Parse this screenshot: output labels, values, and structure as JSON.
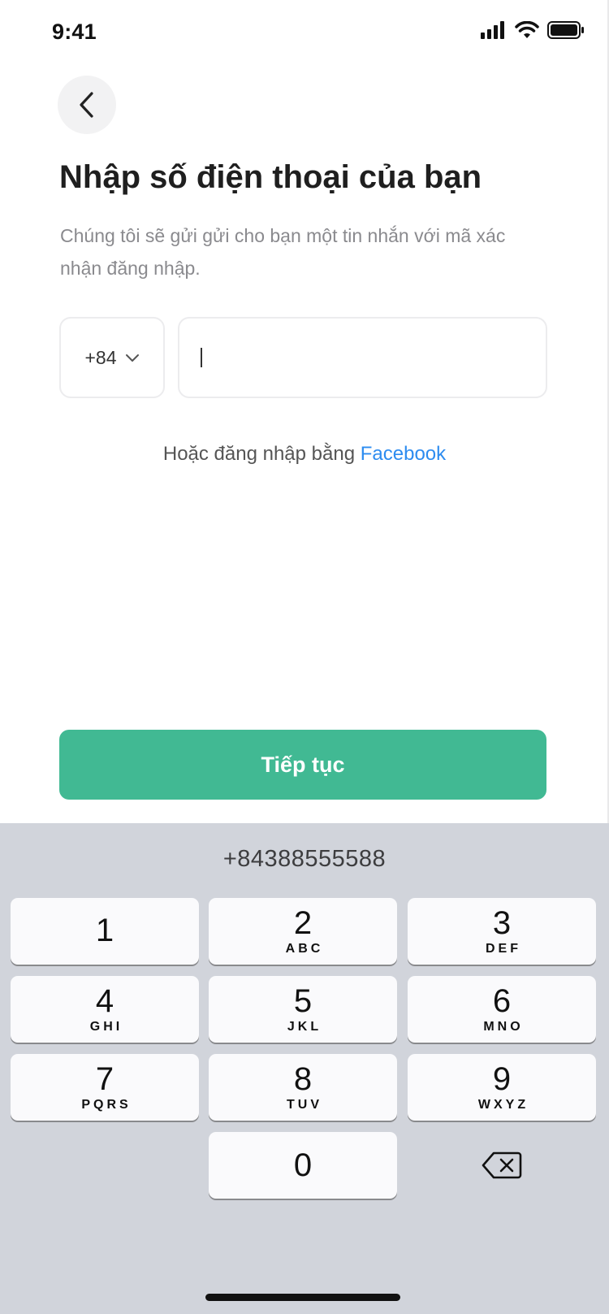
{
  "status_bar": {
    "time": "9:41",
    "icons": [
      "cellular-signal-icon",
      "wifi-icon",
      "battery-icon"
    ]
  },
  "header": {
    "back_icon": "chevron-left-icon",
    "title": "Nhập số điện thoại của bạn",
    "subtitle": "Chúng tôi sẽ gửi gửi cho bạn một tin nhắn với mã xác nhận đăng nhập."
  },
  "form": {
    "country_code": "+84",
    "country_code_icon": "chevron-down-icon",
    "phone_value": ""
  },
  "alt_login": {
    "prefix": "Hoặc đăng nhập bằng",
    "link_label": "Facebook",
    "link_color": "#2d8cf0"
  },
  "continue_button": {
    "label": "Tiếp tục",
    "color": "#41b993"
  },
  "keyboard": {
    "suggestion": "+84388555588",
    "keys": [
      {
        "digit": "1",
        "letters": ""
      },
      {
        "digit": "2",
        "letters": "ABC"
      },
      {
        "digit": "3",
        "letters": "DEF"
      },
      {
        "digit": "4",
        "letters": "GHI"
      },
      {
        "digit": "5",
        "letters": "JKL"
      },
      {
        "digit": "6",
        "letters": "MNO"
      },
      {
        "digit": "7",
        "letters": "PQRS"
      },
      {
        "digit": "8",
        "letters": "TUV"
      },
      {
        "digit": "9",
        "letters": "WXYZ"
      },
      {
        "digit": "0",
        "letters": ""
      }
    ],
    "delete_icon": "backspace-icon"
  }
}
